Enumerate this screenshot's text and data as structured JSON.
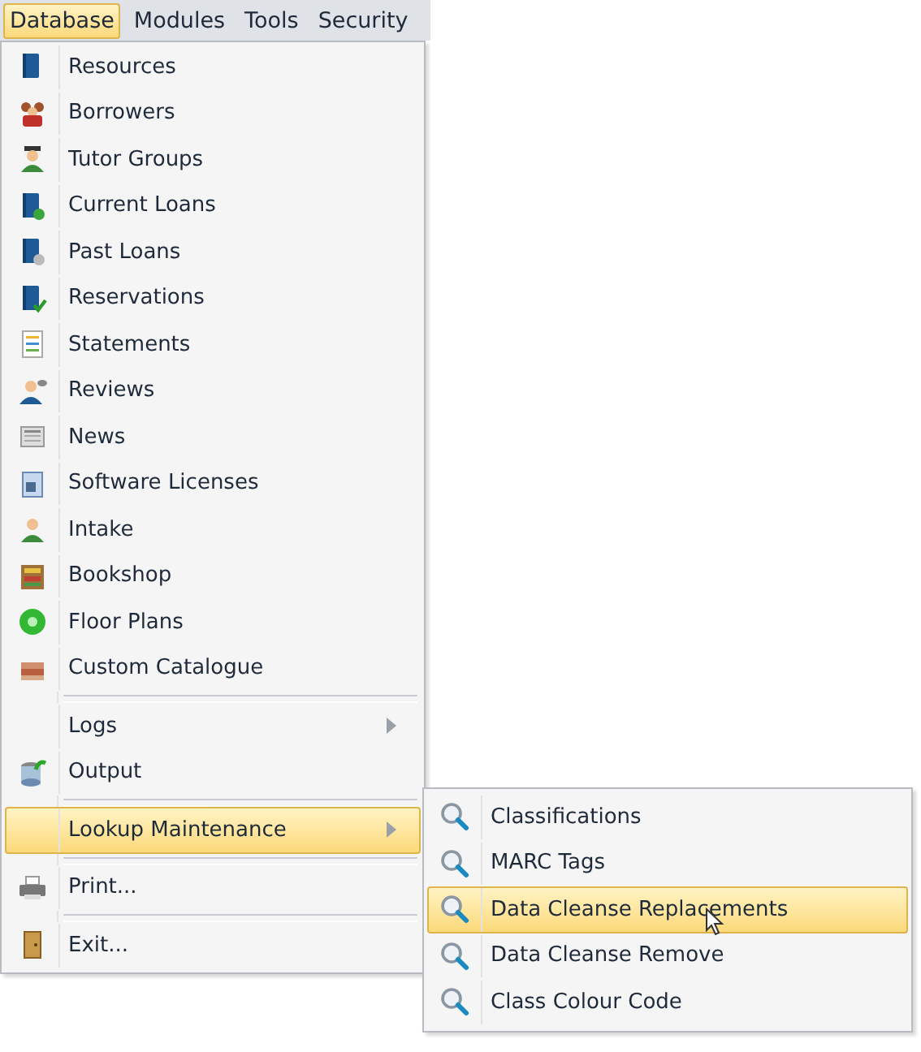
{
  "menubar": [
    {
      "label": "Database",
      "selected": true
    },
    {
      "label": "Modules",
      "selected": false
    },
    {
      "label": "Tools",
      "selected": false
    },
    {
      "label": "Security",
      "selected": false
    }
  ],
  "menu": [
    {
      "kind": "item",
      "label": "Resources"
    },
    {
      "kind": "item",
      "label": "Borrowers"
    },
    {
      "kind": "item",
      "label": "Tutor Groups"
    },
    {
      "kind": "item",
      "label": "Current Loans"
    },
    {
      "kind": "item",
      "label": "Past Loans"
    },
    {
      "kind": "item",
      "label": "Reservations"
    },
    {
      "kind": "item",
      "label": "Statements"
    },
    {
      "kind": "item",
      "label": "Reviews"
    },
    {
      "kind": "item",
      "label": "News"
    },
    {
      "kind": "item",
      "label": "Software Licenses"
    },
    {
      "kind": "item",
      "label": "Intake"
    },
    {
      "kind": "item",
      "label": "Bookshop"
    },
    {
      "kind": "item",
      "label": "Floor Plans"
    },
    {
      "kind": "item",
      "label": "Custom Catalogue"
    },
    {
      "kind": "separator"
    },
    {
      "kind": "submenu",
      "label": "Logs",
      "selected": false
    },
    {
      "kind": "item",
      "label": "Output"
    },
    {
      "kind": "separator"
    },
    {
      "kind": "submenu",
      "label": "Lookup Maintenance",
      "selected": true
    },
    {
      "kind": "separator"
    },
    {
      "kind": "item",
      "label": "Print..."
    },
    {
      "kind": "separator"
    },
    {
      "kind": "item",
      "label": "Exit..."
    }
  ],
  "submenu": [
    {
      "label": "Classifications",
      "selected": false
    },
    {
      "label": "MARC Tags",
      "selected": false
    },
    {
      "label": "Data Cleanse Replacements",
      "selected": true
    },
    {
      "label": "Data Cleanse Remove",
      "selected": false
    },
    {
      "label": "Class Colour Code",
      "selected": false
    }
  ]
}
